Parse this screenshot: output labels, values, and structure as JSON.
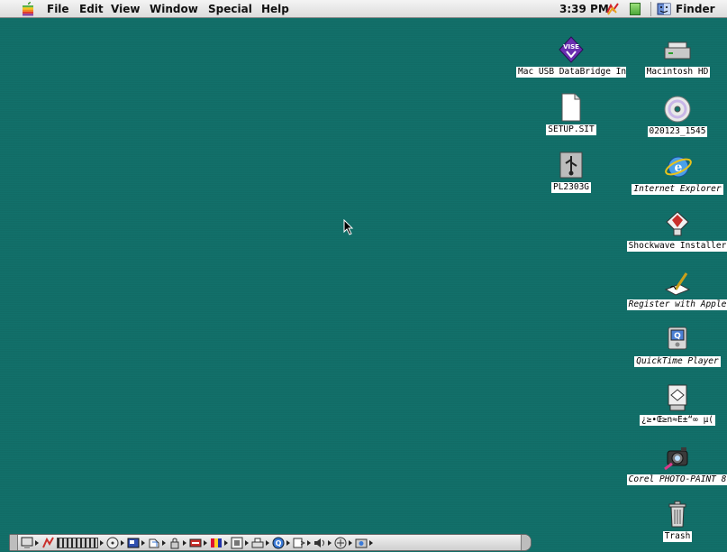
{
  "menubar": {
    "items": [
      "File",
      "Edit",
      "View",
      "Window",
      "Special",
      "Help"
    ],
    "clock": "3:39 PM",
    "active_app": "Finder",
    "icons": [
      "apple-menu-icon",
      "clock-status-icon",
      "battery-icon",
      "finder-app-icon"
    ]
  },
  "desktop": {
    "background_color": "#12706a",
    "icons": [
      {
        "label": "Mac USB DataBridge Installer",
        "icon": "vise-installer-icon",
        "alias": false
      },
      {
        "label": "Macintosh HD",
        "icon": "hard-drive-icon",
        "alias": false
      },
      {
        "label": "SETUP.SIT",
        "icon": "document-icon",
        "alias": false
      },
      {
        "label": "020123_1545",
        "icon": "cd-icon",
        "alias": false
      },
      {
        "label": "PL2303G",
        "icon": "usb-driver-icon",
        "alias": false
      },
      {
        "label": "Internet Explorer",
        "icon": "internet-explorer-icon",
        "alias": true
      },
      {
        "label": "Shockwave Installer",
        "icon": "shockwave-installer-icon",
        "alias": false
      },
      {
        "label": "Register with Apple",
        "icon": "register-icon",
        "alias": true
      },
      {
        "label": "QuickTime Player",
        "icon": "quicktime-icon",
        "alias": true
      },
      {
        "label": "¿≥•Œ≥n≈Ê±“∞ µ(",
        "icon": "application-icon",
        "alias": false
      },
      {
        "label": "Corel PHOTO-PAINT 8",
        "icon": "corel-photo-paint-icon",
        "alias": true
      },
      {
        "label": "Trash",
        "icon": "trash-icon",
        "alias": false
      }
    ]
  },
  "control_strip": {
    "modules": [
      "monitor-icon",
      "battery-monitor-icon",
      "sound-level-bars",
      "cd-strip-icon",
      "monitor-bit-depth-icon",
      "file-sharing-icon",
      "keychain-icon",
      "appletalk-icon",
      "color-depth-icon",
      "resolution-icon",
      "printer-icon",
      "quicktime-strip-icon",
      "web-sharing-icon",
      "speaker-volume-icon",
      "remote-access-icon",
      "location-manager-icon"
    ]
  }
}
